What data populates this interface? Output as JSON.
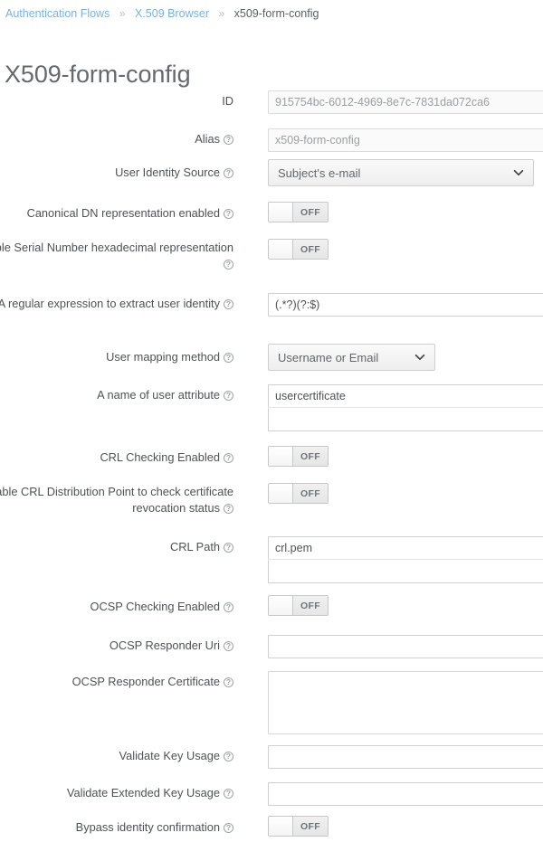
{
  "breadcrumb": {
    "separator": "»",
    "items": [
      {
        "label": "Authentication Flows",
        "type": "link"
      },
      {
        "label": "X.509 Browser",
        "type": "link"
      },
      {
        "label": "x509-form-config",
        "type": "current"
      }
    ]
  },
  "page": {
    "title": "X509-form-config"
  },
  "help_glyph": "?",
  "form": {
    "rows": [
      {
        "key": "id",
        "label": "ID",
        "help": false,
        "control": "text-disabled",
        "value": "915754bc-6012-4969-8e7c-7831da072ca6"
      },
      {
        "key": "alias",
        "label": "Alias",
        "help": true,
        "control": "text-disabled",
        "value": "x509-form-config"
      },
      {
        "key": "user_identity_source",
        "label": "User Identity Source",
        "help": true,
        "control": "select",
        "value": "Subject's e-mail"
      },
      {
        "key": "canonical_dn",
        "label": "Canonical DN representation enabled",
        "help": true,
        "control": "toggle",
        "value": "OFF"
      },
      {
        "key": "serial_hex",
        "label": "Enable Serial Number hexadecimal representation",
        "help": true,
        "control": "toggle",
        "value": "OFF"
      },
      {
        "key": "identity_regex",
        "label": "A regular expression to extract user identity",
        "help": true,
        "control": "text",
        "value": "(.*?)(?:$)"
      },
      {
        "key": "user_mapping_method",
        "label": "User mapping method",
        "help": true,
        "control": "select-narrow",
        "value": "Username or Email"
      },
      {
        "key": "user_attribute_name",
        "label": "A name of user attribute",
        "help": true,
        "control": "text-stacked",
        "value": "usercertificate",
        "value2": ""
      },
      {
        "key": "crl_checking",
        "label": "CRL Checking Enabled",
        "help": true,
        "control": "toggle",
        "value": "OFF"
      },
      {
        "key": "crl_distribution_point",
        "label": "Enable CRL Distribution Point to check certificate revocation status",
        "help": true,
        "control": "toggle",
        "value": "OFF"
      },
      {
        "key": "crl_path",
        "label": "CRL Path",
        "help": true,
        "control": "text-stacked",
        "value": "crl.pem",
        "value2": ""
      },
      {
        "key": "ocsp_checking",
        "label": "OCSP Checking Enabled",
        "help": true,
        "control": "toggle",
        "value": "OFF"
      },
      {
        "key": "ocsp_responder_uri",
        "label": "OCSP Responder Uri",
        "help": true,
        "control": "text",
        "value": ""
      },
      {
        "key": "ocsp_responder_certificate",
        "label": "OCSP Responder Certificate",
        "help": true,
        "control": "textarea",
        "value": ""
      },
      {
        "key": "validate_key_usage",
        "label": "Validate Key Usage",
        "help": true,
        "control": "text",
        "value": ""
      },
      {
        "key": "validate_extended_key_usage",
        "label": "Validate Extended Key Usage",
        "help": true,
        "control": "text",
        "value": ""
      },
      {
        "key": "bypass_identity_confirmation",
        "label": "Bypass identity confirmation",
        "help": true,
        "control": "toggle",
        "value": "OFF"
      }
    ]
  },
  "colors": {
    "link": "#79b3e0",
    "text": "#4d5258",
    "title": "#646a70",
    "border": "#d0d0d0",
    "toggle_track": "#ececec"
  }
}
